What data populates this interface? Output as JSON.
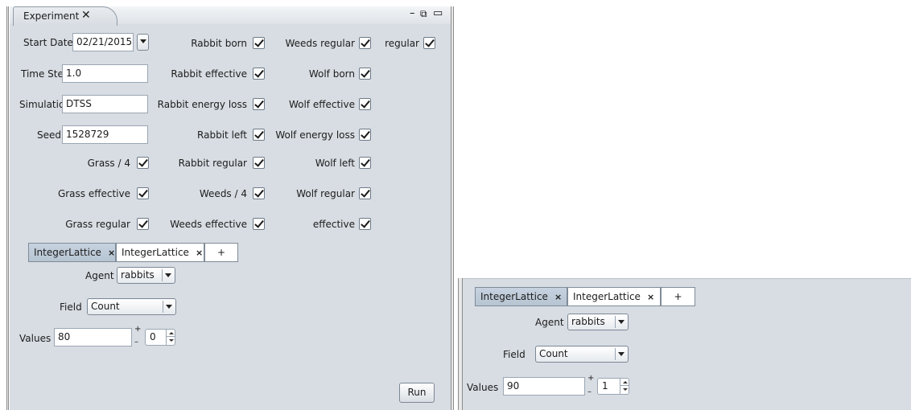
{
  "window": {
    "tab_title": "Experiment",
    "tab_close": "✕",
    "controls": {
      "minimize": "–",
      "restore": "⧉",
      "maximize": "▭"
    }
  },
  "params": {
    "start_date_label": "Start Date",
    "start_date_value": "02/21/2015",
    "time_step_label": "Time Step",
    "time_step_value": "1.0",
    "simulation_label": "Simulation",
    "simulation_value": "DTSS",
    "seed_label": "Seed",
    "seed_value": "1528729"
  },
  "checkboxes": {
    "col1": [
      "Grass / 4",
      "Grass effective",
      "Grass regular"
    ],
    "col2": [
      "Rabbit born",
      "Rabbit effective",
      "Rabbit energy loss",
      "Rabbit left",
      "Rabbit regular",
      "Weeds / 4",
      "Weeds effective"
    ],
    "col3": [
      "Weeds regular",
      "Wolf born",
      "Wolf effective",
      "Wolf energy loss",
      "Wolf left",
      "Wolf regular",
      "effective"
    ],
    "col4": [
      "regular"
    ]
  },
  "left_panel": {
    "tabs": [
      "IntegerLattice",
      "IntegerLattice"
    ],
    "tab_close": "×",
    "add_tab": "+",
    "agent_label": "Agent",
    "agent_value": "rabbits",
    "field_label": "Field",
    "field_value": "Count",
    "values_label": "Values",
    "values_value": "80",
    "spinner_value": "0",
    "plus": "+",
    "minus": "–"
  },
  "run_label": "Run",
  "right_panel": {
    "tabs": [
      "IntegerLattice",
      "IntegerLattice"
    ],
    "tab_close": "×",
    "add_tab": "+",
    "agent_label": "Agent",
    "agent_value": "rabbits",
    "field_label": "Field",
    "field_value": "Count",
    "values_label": "Values",
    "values_value": "90",
    "spinner_value": "1",
    "plus": "+",
    "minus": "–"
  }
}
